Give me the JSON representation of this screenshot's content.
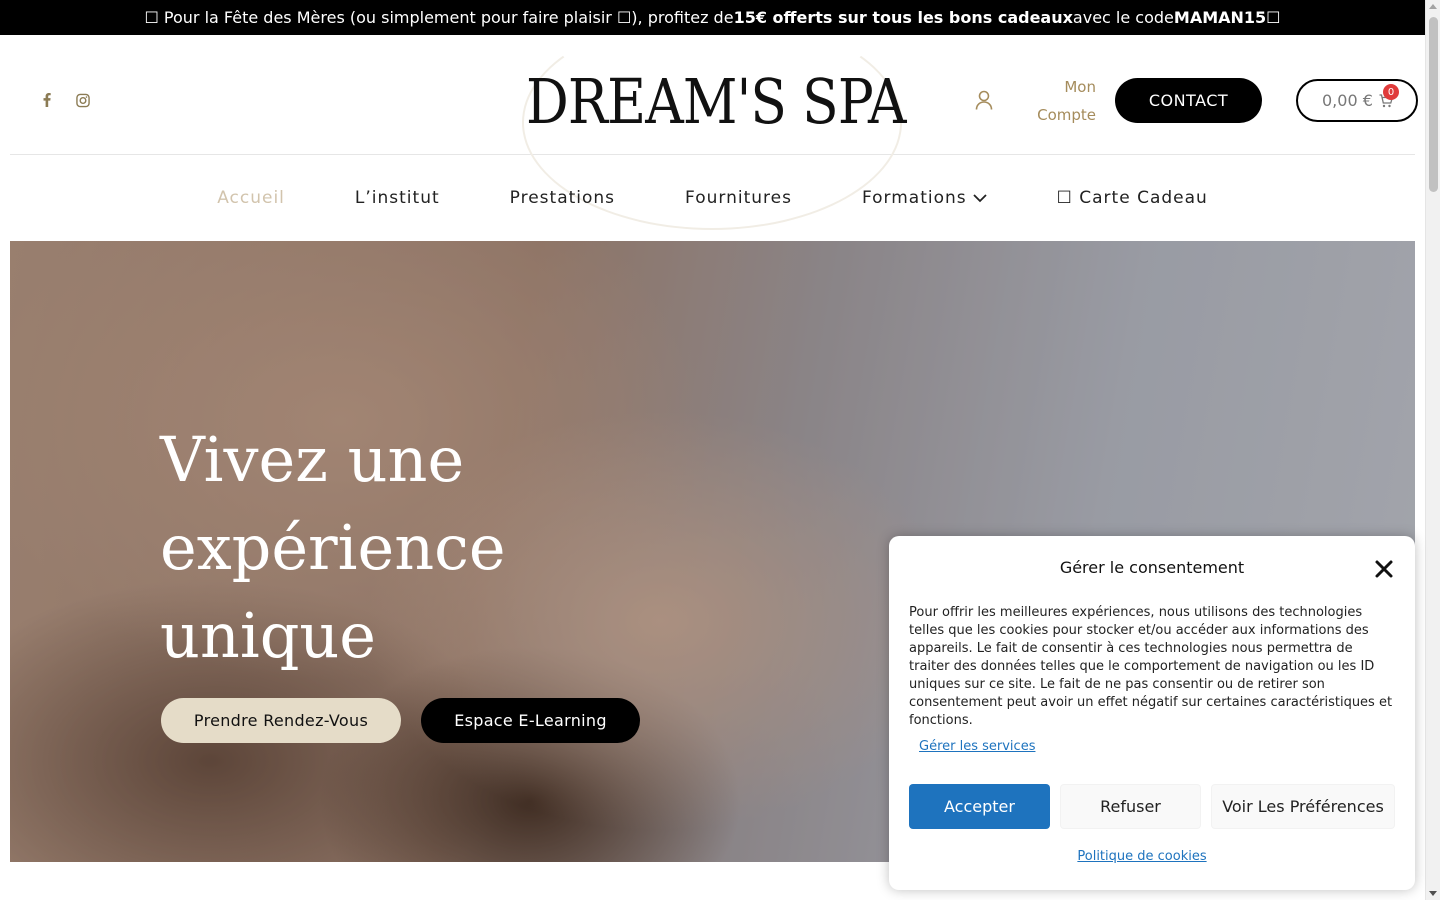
{
  "announcement": {
    "prefix": "☐ Pour la Fête des Mères (ou simplement pour faire plaisir ☐), profitez de ",
    "highlight": "15€ offerts sur tous les bons cadeaux",
    "middle": " avec le code ",
    "code": "MAMAN15",
    "suffix": " ☐"
  },
  "header": {
    "logo_text": "DREAM'S SPA",
    "social": [
      {
        "icon": "facebook-icon",
        "glyph": "f"
      },
      {
        "icon": "instagram-icon",
        "glyph": "◎"
      }
    ],
    "account_label_line1": "Mon",
    "account_label_line2": "Compte",
    "contact_label": "CONTACT",
    "cart_amount": "0,00 €",
    "cart_count": "0",
    "accent_color": "#a58c5c"
  },
  "nav": {
    "items": [
      {
        "label": "Accueil",
        "active": true
      },
      {
        "label": "L’institut"
      },
      {
        "label": "Prestations"
      },
      {
        "label": "Fournitures"
      },
      {
        "label": "Formations",
        "has_dropdown": true
      },
      {
        "label": "☐ Carte Cadeau"
      }
    ]
  },
  "hero": {
    "title_line1": "Vivez une",
    "title_line2": "expérience",
    "title_line3": "unique",
    "primary_button": "Prendre Rendez-Vous",
    "secondary_button": "Espace E-Learning"
  },
  "consent": {
    "title": "Gérer le consentement",
    "body": "Pour offrir les meilleures expériences, nous utilisons des technologies telles que les cookies pour stocker et/ou accéder aux informations des appareils. Le fait de consentir à ces technologies nous permettra de traiter des données telles que le comportement de navigation ou les ID uniques sur ce site. Le fait de ne pas consentir ou de retirer son consentement peut avoir un effet négatif sur certaines caractéristiques et fonctions.",
    "manage_link": "Gérer les services",
    "accept_label": "Accepter",
    "refuse_label": "Refuser",
    "prefs_label": "Voir Les Préférences",
    "policy_link": "Politique de cookies",
    "accept_color": "#1e73be"
  }
}
